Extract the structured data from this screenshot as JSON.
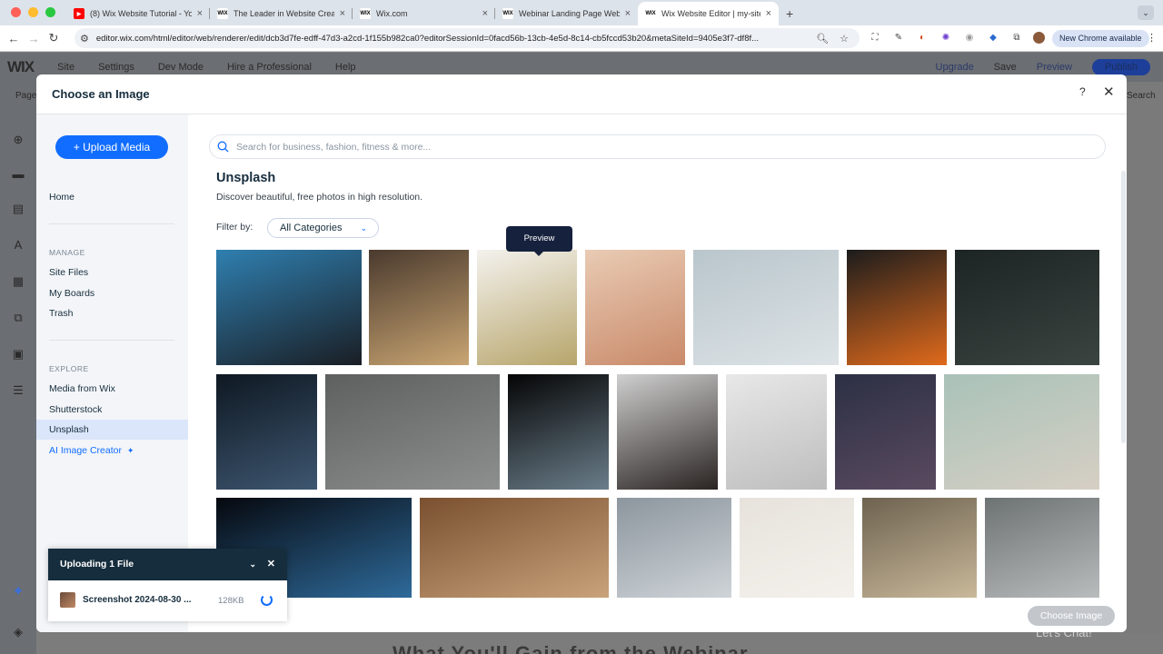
{
  "browser": {
    "tabs": [
      {
        "title": "(8) Wix Website Tutorial - You",
        "favicon": "youtube-icon",
        "fav_text": "▶",
        "fav_color": "#ff0000",
        "active": false
      },
      {
        "title": "The Leader in Website Creati",
        "favicon": "wix-icon",
        "fav_text": "WIX",
        "fav_color": "#ffffff",
        "active": false
      },
      {
        "title": "Wix.com",
        "favicon": "wix-icon",
        "fav_text": "WIX",
        "fav_color": "#ffffff",
        "active": false
      },
      {
        "title": "Webinar Landing Page Websi",
        "favicon": "wix-icon",
        "fav_text": "WIX",
        "fav_color": "#ffffff",
        "active": false
      },
      {
        "title": "Wix Website Editor | my-site-",
        "favicon": "wix-icon",
        "fav_text": "WIX",
        "fav_color": "#ffffff",
        "active": true
      }
    ],
    "url": "editor.wix.com/html/editor/web/renderer/edit/dcb3d7fe-edff-47d3-a2cd-1f155b982ca0?editorSessionId=0facd56b-13cb-4e5d-8c14-cb5fccd53b20&metaSiteId=9405e3f7-df8f...",
    "new_chrome": "New Chrome available"
  },
  "editor": {
    "logo": "WIX",
    "menu": [
      "Site",
      "Settings",
      "Dev Mode",
      "Hire a Professional",
      "Help"
    ],
    "upgrade": "Upgrade",
    "save": "Save",
    "preview": "Preview",
    "publish": "Publish",
    "page_label": "Page",
    "search_label": "Search",
    "canvas_heading": "What You'll Gain from the Webinar",
    "chat": "Let's Chat!"
  },
  "modal": {
    "title": "Choose an Image",
    "help": "?",
    "close": "✕",
    "upload_button": "+ Upload Media",
    "sidebar": {
      "home": "Home",
      "manage_heading": "MANAGE",
      "manage_items": [
        "Site Files",
        "My Boards",
        "Trash"
      ],
      "explore_heading": "EXPLORE",
      "explore_items": [
        "Media from Wix",
        "Shutterstock",
        "Unsplash"
      ],
      "ai_creator": "AI Image Creator",
      "active_item": "Unsplash"
    },
    "search_placeholder": "Search for business, fashion, fitness & more...",
    "section_title": "Unsplash",
    "section_desc": "Discover beautiful, free photos in high resolution.",
    "filter_label": "Filter by:",
    "filter_value": "All Categories",
    "tooltip": "Preview",
    "choose_button": "Choose Image"
  },
  "upload_panel": {
    "title": "Uploading 1 File",
    "file_name": "Screenshot 2024-08-30 ...",
    "file_size": "128KB"
  },
  "images": [
    {
      "name": "camera-gimbal-photo",
      "colors": [
        "#2f7fb0",
        "#1a1e24"
      ]
    },
    {
      "name": "window-room-photo",
      "colors": [
        "#4a3a2e",
        "#c9a572"
      ]
    },
    {
      "name": "white-flower-photo",
      "colors": [
        "#f4f2ee",
        "#b7a56b"
      ]
    },
    {
      "name": "city-poster-photo",
      "colors": [
        "#e9cbb4",
        "#c98a6a"
      ]
    },
    {
      "name": "desert-sculpture-photo",
      "colors": [
        "#b9c6cc",
        "#dde3e6"
      ]
    },
    {
      "name": "car-window-person-photo",
      "colors": [
        "#1c1c1c",
        "#e06a1c"
      ]
    },
    {
      "name": "dark-mountain-photo",
      "colors": [
        "#1d2424",
        "#3a4440"
      ]
    },
    {
      "name": "sparkling-water-photo",
      "colors": [
        "#0e1822",
        "#3e5670"
      ]
    },
    {
      "name": "penguin-colony-photo",
      "colors": [
        "#5e6060",
        "#8e9090"
      ]
    },
    {
      "name": "space-rock-photo",
      "colors": [
        "#050505",
        "#6a7d8a"
      ]
    },
    {
      "name": "dj-mixer-photo",
      "colors": [
        "#cfcfcf",
        "#2a2422"
      ]
    },
    {
      "name": "cyclist-white-photo",
      "colors": [
        "#e8e8e8",
        "#bdbdbd"
      ]
    },
    {
      "name": "monolith-dusk-photo",
      "colors": [
        "#2c3044",
        "#5a4a60"
      ]
    },
    {
      "name": "aerial-terrain-photo",
      "colors": [
        "#a9c2b8",
        "#d6cfc4"
      ]
    },
    {
      "name": "nebula-space-photo",
      "colors": [
        "#06080e",
        "#2e6a9a"
      ]
    },
    {
      "name": "wooden-office-photo",
      "colors": [
        "#7a5030",
        "#c9a27a"
      ]
    },
    {
      "name": "foggy-building-photo",
      "colors": [
        "#8c969e",
        "#cfd4d8"
      ]
    },
    {
      "name": "hoodie-sunglasses-photo",
      "colors": [
        "#e7e2dc",
        "#f4f1ec"
      ]
    },
    {
      "name": "dried-flowers-photo",
      "colors": [
        "#6e6250",
        "#c9b99a"
      ]
    },
    {
      "name": "mountain-valley-photo",
      "colors": [
        "#6d7272",
        "#b9bcbc"
      ]
    }
  ],
  "colors": {
    "accent": "#116dff",
    "dark_panel": "#162d3d"
  }
}
